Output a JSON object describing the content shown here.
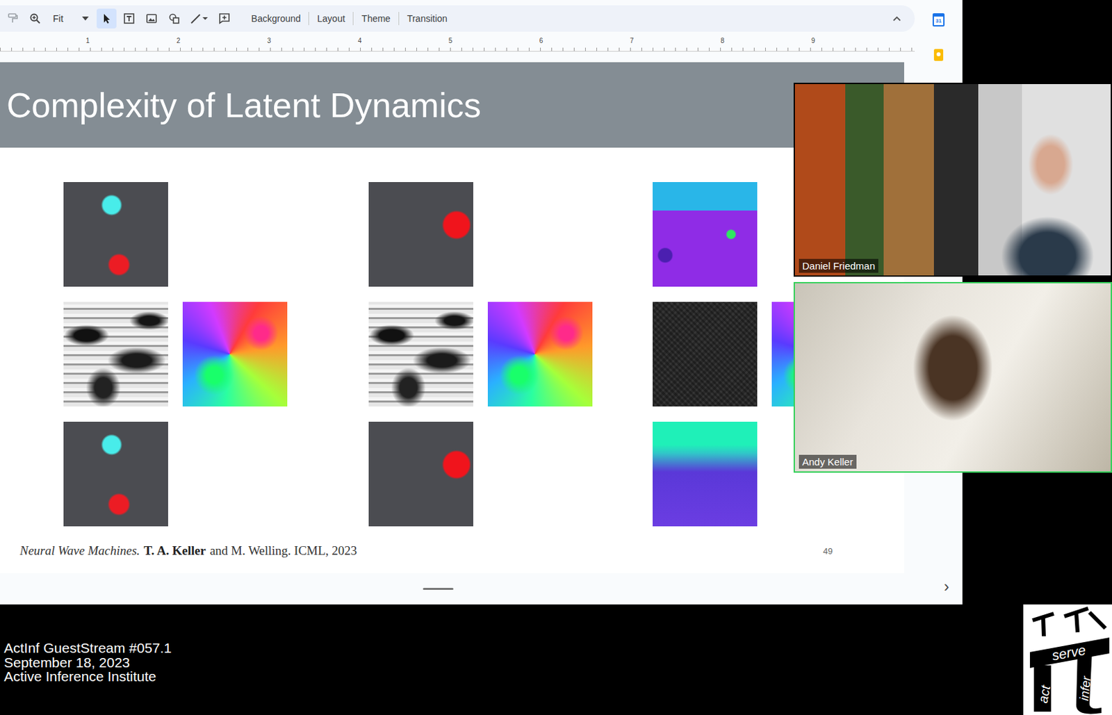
{
  "toolbar": {
    "tools": [
      {
        "kind": "paint",
        "selected": false
      },
      {
        "kind": "zoom",
        "selected": false
      },
      {
        "kind": "zoom-select",
        "label": "Fit",
        "selected": false
      },
      {
        "kind": "cursor",
        "selected": true
      },
      {
        "kind": "textbox",
        "selected": false
      },
      {
        "kind": "image",
        "selected": false
      },
      {
        "kind": "shapes",
        "selected": false
      },
      {
        "kind": "line",
        "selected": false
      },
      {
        "kind": "comment",
        "selected": false
      }
    ],
    "menu": [
      "Background",
      "Layout",
      "Theme",
      "Transition"
    ]
  },
  "ruler": [
    "1",
    "2",
    "3",
    "4",
    "5",
    "6",
    "7",
    "8",
    "9"
  ],
  "side_panel": {
    "calendar_day": "31"
  },
  "slide": {
    "title": "Complexity of Latent Dynamics",
    "figure_groups": [
      {
        "rows": [
          [
            "scene"
          ],
          [
            "noise",
            "phase"
          ],
          [
            "scene"
          ]
        ]
      },
      {
        "rows": [
          [
            "scene"
          ],
          [
            "noise",
            "phase"
          ],
          [
            "scene"
          ]
        ]
      },
      {
        "rows": [
          [
            "render"
          ],
          [
            "noise",
            "phase"
          ],
          [
            "depth"
          ]
        ]
      }
    ],
    "citation": {
      "title": "Neural Wave Machines.",
      "authors": "T. A. Keller",
      "rest": "and M. Welling. ICML, 2023"
    },
    "page": "49"
  },
  "next_arrow": "›",
  "participants": [
    {
      "name": "Daniel Friedman",
      "speaking": false
    },
    {
      "name": "Andy Keller",
      "speaking": true
    }
  ],
  "stream": {
    "lines": [
      "ActInf GuestStream #057.1",
      "September 18, 2023",
      "Active Inference Institute"
    ]
  },
  "logo": {
    "top": "serve",
    "left": "act",
    "right": "infer"
  }
}
